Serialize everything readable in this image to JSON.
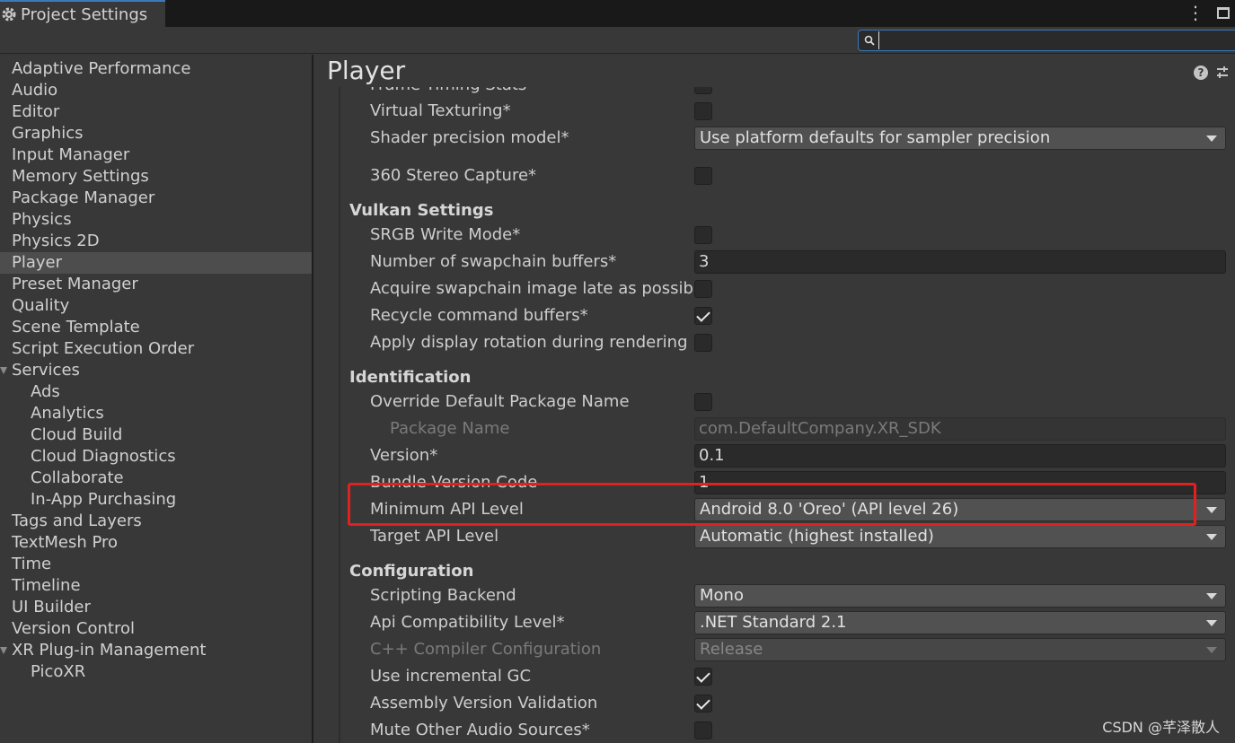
{
  "window": {
    "tab_title": "Project Settings",
    "icons": [
      "gear-icon",
      "kebab-menu-icon",
      "maximize-icon"
    ]
  },
  "search": {
    "value": "",
    "placeholder": ""
  },
  "sidebar": {
    "items": [
      {
        "label": "Adaptive Performance"
      },
      {
        "label": "Audio"
      },
      {
        "label": "Editor"
      },
      {
        "label": "Graphics"
      },
      {
        "label": "Input Manager"
      },
      {
        "label": "Memory Settings"
      },
      {
        "label": "Package Manager"
      },
      {
        "label": "Physics"
      },
      {
        "label": "Physics 2D"
      },
      {
        "label": "Player",
        "selected": true
      },
      {
        "label": "Preset Manager"
      },
      {
        "label": "Quality"
      },
      {
        "label": "Scene Template"
      },
      {
        "label": "Script Execution Order"
      },
      {
        "label": "Services",
        "expanded": true
      },
      {
        "label": "Ads"
      },
      {
        "label": "Analytics"
      },
      {
        "label": "Cloud Build"
      },
      {
        "label": "Cloud Diagnostics"
      },
      {
        "label": "Collaborate"
      },
      {
        "label": "In-App Purchasing"
      },
      {
        "label": "Tags and Layers"
      },
      {
        "label": "TextMesh Pro"
      },
      {
        "label": "Time"
      },
      {
        "label": "Timeline"
      },
      {
        "label": "UI Builder"
      },
      {
        "label": "Version Control"
      },
      {
        "label": "XR Plug-in Management",
        "expanded": true
      },
      {
        "label": "PicoXR"
      }
    ]
  },
  "main": {
    "title": "Player",
    "partial_row": {
      "label": "Frame Timing Stats"
    },
    "rows_top": [
      {
        "label": "Virtual Texturing*",
        "type": "checkbox",
        "checked": false
      },
      {
        "label": "Shader precision model*",
        "type": "dropdown",
        "value": "Use platform defaults for sampler precision"
      },
      {
        "label": "360 Stereo Capture*",
        "type": "checkbox",
        "checked": false
      }
    ],
    "vulkan": {
      "title": "Vulkan Settings",
      "rows": [
        {
          "label": "SRGB Write Mode*",
          "type": "checkbox",
          "checked": false
        },
        {
          "label": "Number of swapchain buffers*",
          "type": "field",
          "value": "3"
        },
        {
          "label": "Acquire swapchain image late as possible*",
          "type": "checkbox",
          "checked": false
        },
        {
          "label": "Recycle command buffers*",
          "type": "checkbox",
          "checked": true
        },
        {
          "label": "Apply display rotation during rendering",
          "type": "checkbox",
          "checked": false
        }
      ]
    },
    "identification": {
      "title": "Identification",
      "rows": [
        {
          "label": "Override Default Package Name",
          "type": "checkbox",
          "checked": false
        },
        {
          "label": "Package Name",
          "type": "field",
          "value": "com.DefaultCompany.XR_SDK",
          "disabled": true
        },
        {
          "label": "Version*",
          "type": "field",
          "value": "0.1"
        },
        {
          "label": "Bundle Version Code",
          "type": "field",
          "value": "1"
        },
        {
          "label": "Minimum API Level",
          "type": "dropdown",
          "value": "Android 8.0 'Oreo' (API level 26)"
        },
        {
          "label": "Target API Level",
          "type": "dropdown",
          "value": "Automatic (highest installed)"
        }
      ]
    },
    "configuration": {
      "title": "Configuration",
      "rows": [
        {
          "label": "Scripting Backend",
          "type": "dropdown",
          "value": "Mono"
        },
        {
          "label": "Api Compatibility Level*",
          "type": "dropdown",
          "value": ".NET Standard 2.1"
        },
        {
          "label": "C++ Compiler Configuration",
          "type": "dropdown",
          "value": "Release",
          "disabled": true
        },
        {
          "label": "Use incremental GC",
          "type": "checkbox",
          "checked": true
        },
        {
          "label": "Assembly Version Validation",
          "type": "checkbox",
          "checked": true
        },
        {
          "label": "Mute Other Audio Sources*",
          "type": "checkbox",
          "checked": false
        }
      ]
    }
  },
  "watermark": "CSDN @芊泽散人",
  "colors": {
    "highlight": "#e0211f",
    "accent": "#3a79bb"
  }
}
